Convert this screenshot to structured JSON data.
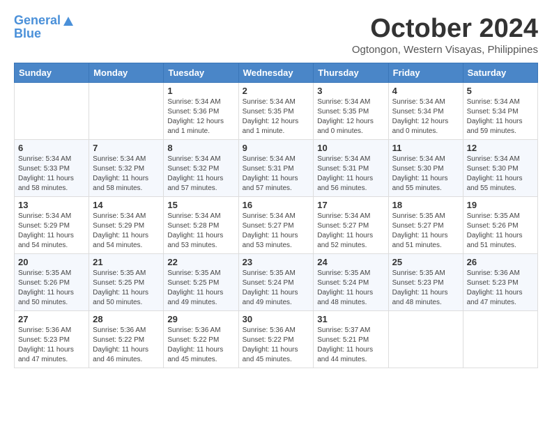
{
  "header": {
    "logo_line1": "General",
    "logo_line2": "Blue",
    "month": "October 2024",
    "location": "Ogtongon, Western Visayas, Philippines"
  },
  "weekdays": [
    "Sunday",
    "Monday",
    "Tuesday",
    "Wednesday",
    "Thursday",
    "Friday",
    "Saturday"
  ],
  "weeks": [
    [
      {
        "day": "",
        "sunrise": "",
        "sunset": "",
        "daylight": ""
      },
      {
        "day": "",
        "sunrise": "",
        "sunset": "",
        "daylight": ""
      },
      {
        "day": "1",
        "sunrise": "Sunrise: 5:34 AM",
        "sunset": "Sunset: 5:36 PM",
        "daylight": "Daylight: 12 hours and 1 minute."
      },
      {
        "day": "2",
        "sunrise": "Sunrise: 5:34 AM",
        "sunset": "Sunset: 5:35 PM",
        "daylight": "Daylight: 12 hours and 1 minute."
      },
      {
        "day": "3",
        "sunrise": "Sunrise: 5:34 AM",
        "sunset": "Sunset: 5:35 PM",
        "daylight": "Daylight: 12 hours and 0 minutes."
      },
      {
        "day": "4",
        "sunrise": "Sunrise: 5:34 AM",
        "sunset": "Sunset: 5:34 PM",
        "daylight": "Daylight: 12 hours and 0 minutes."
      },
      {
        "day": "5",
        "sunrise": "Sunrise: 5:34 AM",
        "sunset": "Sunset: 5:34 PM",
        "daylight": "Daylight: 11 hours and 59 minutes."
      }
    ],
    [
      {
        "day": "6",
        "sunrise": "Sunrise: 5:34 AM",
        "sunset": "Sunset: 5:33 PM",
        "daylight": "Daylight: 11 hours and 58 minutes."
      },
      {
        "day": "7",
        "sunrise": "Sunrise: 5:34 AM",
        "sunset": "Sunset: 5:32 PM",
        "daylight": "Daylight: 11 hours and 58 minutes."
      },
      {
        "day": "8",
        "sunrise": "Sunrise: 5:34 AM",
        "sunset": "Sunset: 5:32 PM",
        "daylight": "Daylight: 11 hours and 57 minutes."
      },
      {
        "day": "9",
        "sunrise": "Sunrise: 5:34 AM",
        "sunset": "Sunset: 5:31 PM",
        "daylight": "Daylight: 11 hours and 57 minutes."
      },
      {
        "day": "10",
        "sunrise": "Sunrise: 5:34 AM",
        "sunset": "Sunset: 5:31 PM",
        "daylight": "Daylight: 11 hours and 56 minutes."
      },
      {
        "day": "11",
        "sunrise": "Sunrise: 5:34 AM",
        "sunset": "Sunset: 5:30 PM",
        "daylight": "Daylight: 11 hours and 55 minutes."
      },
      {
        "day": "12",
        "sunrise": "Sunrise: 5:34 AM",
        "sunset": "Sunset: 5:30 PM",
        "daylight": "Daylight: 11 hours and 55 minutes."
      }
    ],
    [
      {
        "day": "13",
        "sunrise": "Sunrise: 5:34 AM",
        "sunset": "Sunset: 5:29 PM",
        "daylight": "Daylight: 11 hours and 54 minutes."
      },
      {
        "day": "14",
        "sunrise": "Sunrise: 5:34 AM",
        "sunset": "Sunset: 5:29 PM",
        "daylight": "Daylight: 11 hours and 54 minutes."
      },
      {
        "day": "15",
        "sunrise": "Sunrise: 5:34 AM",
        "sunset": "Sunset: 5:28 PM",
        "daylight": "Daylight: 11 hours and 53 minutes."
      },
      {
        "day": "16",
        "sunrise": "Sunrise: 5:34 AM",
        "sunset": "Sunset: 5:27 PM",
        "daylight": "Daylight: 11 hours and 53 minutes."
      },
      {
        "day": "17",
        "sunrise": "Sunrise: 5:34 AM",
        "sunset": "Sunset: 5:27 PM",
        "daylight": "Daylight: 11 hours and 52 minutes."
      },
      {
        "day": "18",
        "sunrise": "Sunrise: 5:35 AM",
        "sunset": "Sunset: 5:27 PM",
        "daylight": "Daylight: 11 hours and 51 minutes."
      },
      {
        "day": "19",
        "sunrise": "Sunrise: 5:35 AM",
        "sunset": "Sunset: 5:26 PM",
        "daylight": "Daylight: 11 hours and 51 minutes."
      }
    ],
    [
      {
        "day": "20",
        "sunrise": "Sunrise: 5:35 AM",
        "sunset": "Sunset: 5:26 PM",
        "daylight": "Daylight: 11 hours and 50 minutes."
      },
      {
        "day": "21",
        "sunrise": "Sunrise: 5:35 AM",
        "sunset": "Sunset: 5:25 PM",
        "daylight": "Daylight: 11 hours and 50 minutes."
      },
      {
        "day": "22",
        "sunrise": "Sunrise: 5:35 AM",
        "sunset": "Sunset: 5:25 PM",
        "daylight": "Daylight: 11 hours and 49 minutes."
      },
      {
        "day": "23",
        "sunrise": "Sunrise: 5:35 AM",
        "sunset": "Sunset: 5:24 PM",
        "daylight": "Daylight: 11 hours and 49 minutes."
      },
      {
        "day": "24",
        "sunrise": "Sunrise: 5:35 AM",
        "sunset": "Sunset: 5:24 PM",
        "daylight": "Daylight: 11 hours and 48 minutes."
      },
      {
        "day": "25",
        "sunrise": "Sunrise: 5:35 AM",
        "sunset": "Sunset: 5:23 PM",
        "daylight": "Daylight: 11 hours and 48 minutes."
      },
      {
        "day": "26",
        "sunrise": "Sunrise: 5:36 AM",
        "sunset": "Sunset: 5:23 PM",
        "daylight": "Daylight: 11 hours and 47 minutes."
      }
    ],
    [
      {
        "day": "27",
        "sunrise": "Sunrise: 5:36 AM",
        "sunset": "Sunset: 5:23 PM",
        "daylight": "Daylight: 11 hours and 47 minutes."
      },
      {
        "day": "28",
        "sunrise": "Sunrise: 5:36 AM",
        "sunset": "Sunset: 5:22 PM",
        "daylight": "Daylight: 11 hours and 46 minutes."
      },
      {
        "day": "29",
        "sunrise": "Sunrise: 5:36 AM",
        "sunset": "Sunset: 5:22 PM",
        "daylight": "Daylight: 11 hours and 45 minutes."
      },
      {
        "day": "30",
        "sunrise": "Sunrise: 5:36 AM",
        "sunset": "Sunset: 5:22 PM",
        "daylight": "Daylight: 11 hours and 45 minutes."
      },
      {
        "day": "31",
        "sunrise": "Sunrise: 5:37 AM",
        "sunset": "Sunset: 5:21 PM",
        "daylight": "Daylight: 11 hours and 44 minutes."
      },
      {
        "day": "",
        "sunrise": "",
        "sunset": "",
        "daylight": ""
      },
      {
        "day": "",
        "sunrise": "",
        "sunset": "",
        "daylight": ""
      }
    ]
  ]
}
